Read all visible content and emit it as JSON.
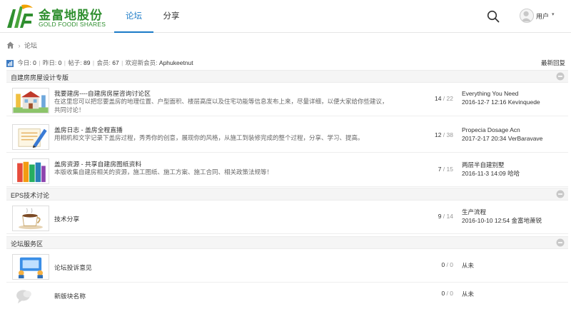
{
  "header": {
    "logo_cn": "金富地股份",
    "logo_en": "GOLD FOODI SHARES",
    "tabs": [
      {
        "label": "论坛",
        "active": true
      },
      {
        "label": "分享",
        "active": false
      }
    ],
    "search_icon": "search-icon",
    "user_label": "用户",
    "user_caret": "▾"
  },
  "breadcrumb": {
    "home_icon": "home-icon",
    "separator": "›",
    "current": "论坛"
  },
  "stats": {
    "today_label": "今日:",
    "today_value": "0",
    "yesterday_label": "昨日:",
    "yesterday_value": "0",
    "posts_label": "帖子:",
    "posts_value": "89",
    "members_label": "会员:",
    "members_value": "67",
    "newest_label": "欢迎新会员:",
    "newest_value": "Aphukeetnut",
    "separator": "|",
    "latest_replies": "最新回复"
  },
  "categories": [
    {
      "title": "自建房房屋设计专版",
      "forums": [
        {
          "icon": "house-building-icon",
          "name": "我要建房----自建房房屋咨询讨论区",
          "desc": "在这里您可以把您要盖房的地理位置、户型面积、楼层高度以及住宅功能等信息发布上来，尽量详细，以便大家给你些建议，共同讨论！",
          "threads": "14",
          "posts": "22",
          "last_title": "Everything You Need",
          "last_meta": "2016-12-7 12:16 Kevinquede"
        },
        {
          "icon": "diary-pen-icon",
          "name": "盖房日志 - 盖房全程直播",
          "desc": "用相机和文字记录下盖房过程，秀秀你的创意，展现你的风格，从施工到装修完成的整个过程，分享、学习、提高。",
          "threads": "12",
          "posts": "38",
          "last_title": "Propecia Dosage Acn",
          "last_meta": "2017-2-17 20:34 VerBaravave"
        },
        {
          "icon": "books-icon",
          "name": "盖房资源 - 共享自建房图纸资料",
          "desc": "本版收集自建房相关的资源，施工图纸、施工方案、施工合同、相关政策法规等！",
          "threads": "7",
          "posts": "15",
          "last_title": "两层半自建别墅",
          "last_meta": "2016-11-3 14:09 哈哈"
        }
      ]
    },
    {
      "title": "EPS技术讨论",
      "forums": [
        {
          "icon": "coffee-cup-icon",
          "name": "技术分享",
          "desc": "",
          "threads": "9",
          "posts": "14",
          "last_title": "生产流程",
          "last_meta": "2016-10-10 12:54 金富地萧锐"
        }
      ]
    },
    {
      "title": "论坛服务区",
      "forums": [
        {
          "icon": "feedback-people-icon",
          "name": "论坛投诉意见",
          "desc": "",
          "threads": "0",
          "posts": "0",
          "last_single": "从未"
        },
        {
          "icon": "chat-bubble-icon",
          "name": "新版块名称",
          "desc": "",
          "threads": "0",
          "posts": "0",
          "last_single": "从未"
        }
      ]
    }
  ],
  "colors": {
    "brand_green": "#2f8f2f",
    "link_blue": "#1a7ac7"
  }
}
